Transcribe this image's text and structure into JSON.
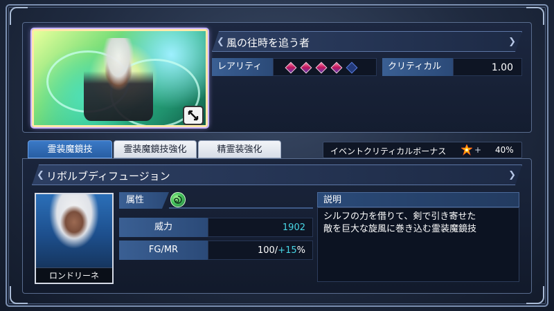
{
  "card": {
    "title": "風の往時を追う者",
    "rarity_label": "レアリティ",
    "rarity": {
      "filled": 4,
      "total": 5
    },
    "critical_label": "クリティカル",
    "critical_value": "1.00"
  },
  "tabs": [
    {
      "label": "霊装魔鏡技",
      "active": true
    },
    {
      "label": "霊装魔鏡技強化",
      "active": false
    },
    {
      "label": "精霊装強化",
      "active": false
    }
  ],
  "event_bonus": {
    "label": "イベントクリティカルボーナス",
    "plus": "+",
    "value": "40%"
  },
  "skill": {
    "name": "リボルブディフュージョン",
    "attribute_label": "属性",
    "attribute_icon": "wind-element-icon",
    "power_label": "威力",
    "power_value": "1902",
    "fgmr_label": "FG/MR",
    "fgmr_base": "100/",
    "fgmr_bonus_sign": "+",
    "fgmr_bonus_value": "15",
    "fgmr_unit": "%",
    "description_label": "説明",
    "description_line1": "シルフの力を借りて、剣で引き寄せた",
    "description_line2": "敵を巨大な旋風に巻き込む霊装魔鏡技"
  },
  "character": {
    "name": "ロンドリーネ"
  },
  "colors": {
    "active_tab": "#3a79c6",
    "label_blue": "#3a5f93",
    "bonus_teal": "#48d7e6",
    "gem_filled": "#c2185b",
    "gem_empty": "#233a7a"
  }
}
